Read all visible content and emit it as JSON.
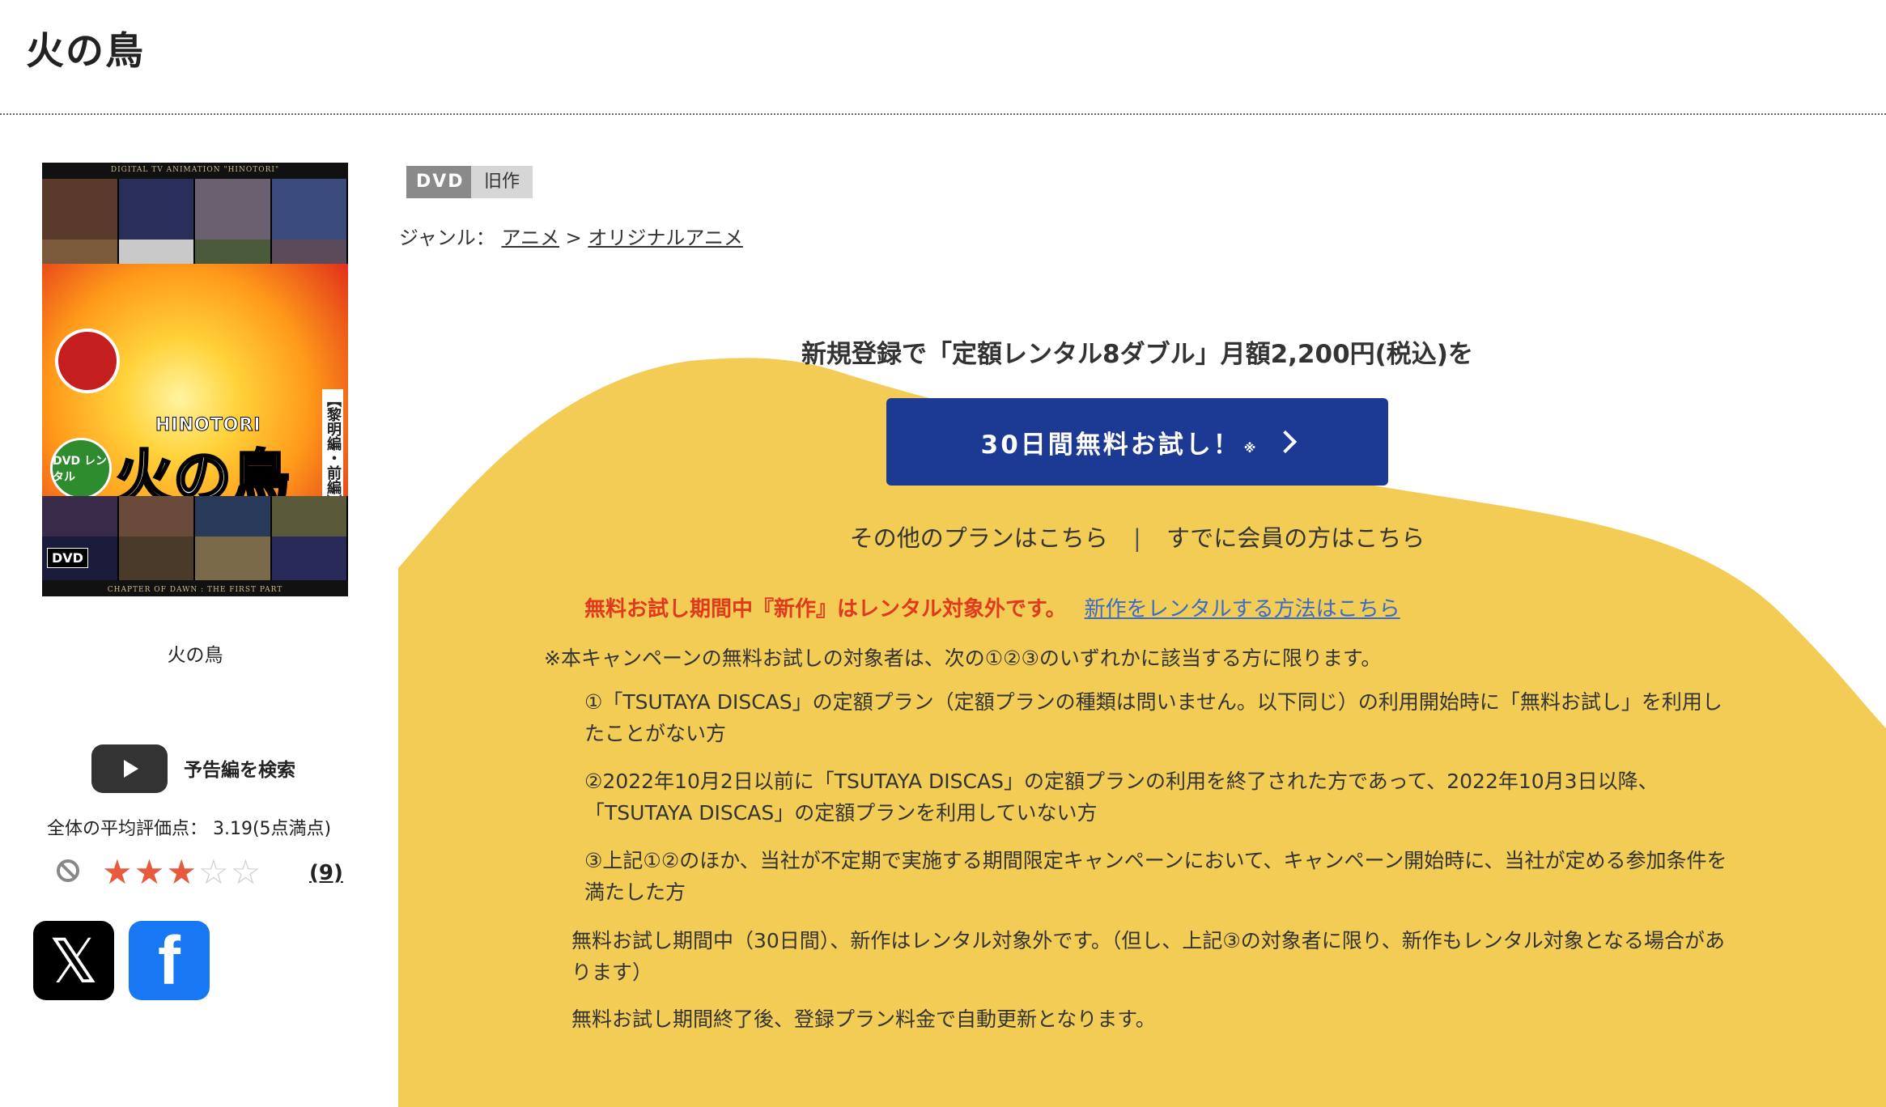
{
  "page": {
    "title": "火の鳥"
  },
  "cover": {
    "top_text": "DIGITAL TV ANIMATION \"HINOTORI\"",
    "logo_en": "HINOTORI",
    "logo_jp": "火の鳥",
    "subtitle": "【黎明編・前編】",
    "rental_badge": "DVD レンタル",
    "dvd_mark": "DVD",
    "bottom_text": "CHAPTER OF DAWN : THE FIRST PART",
    "caption": "火の鳥"
  },
  "trailer": {
    "label": "予告編を検索",
    "icon": "play-icon"
  },
  "rating": {
    "average_label": "全体の平均評価点： 3.19(5点満点)",
    "average": 3.19,
    "max": 5,
    "stars_filled": 3,
    "review_count": "(9)"
  },
  "social": {
    "x_icon": "x-logo-icon",
    "x_glyph": "𝕏",
    "facebook_icon": "facebook-logo-icon",
    "facebook_glyph": "f"
  },
  "tags": {
    "format": "DVD",
    "status": "旧作"
  },
  "genre": {
    "label": "ジャンル：",
    "items": [
      "アニメ",
      "オリジナルアニメ"
    ],
    "separator": ">"
  },
  "promo": {
    "headline": "新規登録で「定額レンタル8ダブル」月額2,200円(税込)を",
    "cta_label": "30日間無料お試し！",
    "cta_note": "※",
    "other_plans": "その他のプランはこちら",
    "plan_separator": "|",
    "members": "すでに会員の方はこちら",
    "warning": "無料お試し期間中『新作』はレンタル対象外です。",
    "warning_link": "新作をレンタルする方法はこちら",
    "conditions_intro": "※本キャンペーンの無料お試しの対象者は、次の①②③のいずれかに該当する方に限ります。",
    "conditions": [
      "①「TSUTAYA DISCAS」の定額プラン（定額プランの種類は問いません。以下同じ）の利用開始時に「無料お試し」を利用したことがない方",
      "②2022年10月2日以前に「TSUTAYA DISCAS」の定額プランの利用を終了された方であって、2022年10月3日以降、「TSUTAYA DISCAS」の定額プランを利用していない方",
      "③上記①②のほか、当社が不定期で実施する期間限定キャンペーンにおいて、キャンペーン開始時に、当社が定める参加条件を満たした方"
    ],
    "note1": "無料お試し期間中（30日間）、新作はレンタル対象外です。（但し、上記③の対象者に限り、新作もレンタル対象となる場合があります）",
    "note2": "無料お試し期間終了後、登録プラン料金で自動更新となります。"
  },
  "colors": {
    "cta": "#1c3a94",
    "promo_bg": "#f2cc54",
    "warning": "#e03a1e",
    "link": "#3a6bc9",
    "star": "#e85a3d"
  }
}
